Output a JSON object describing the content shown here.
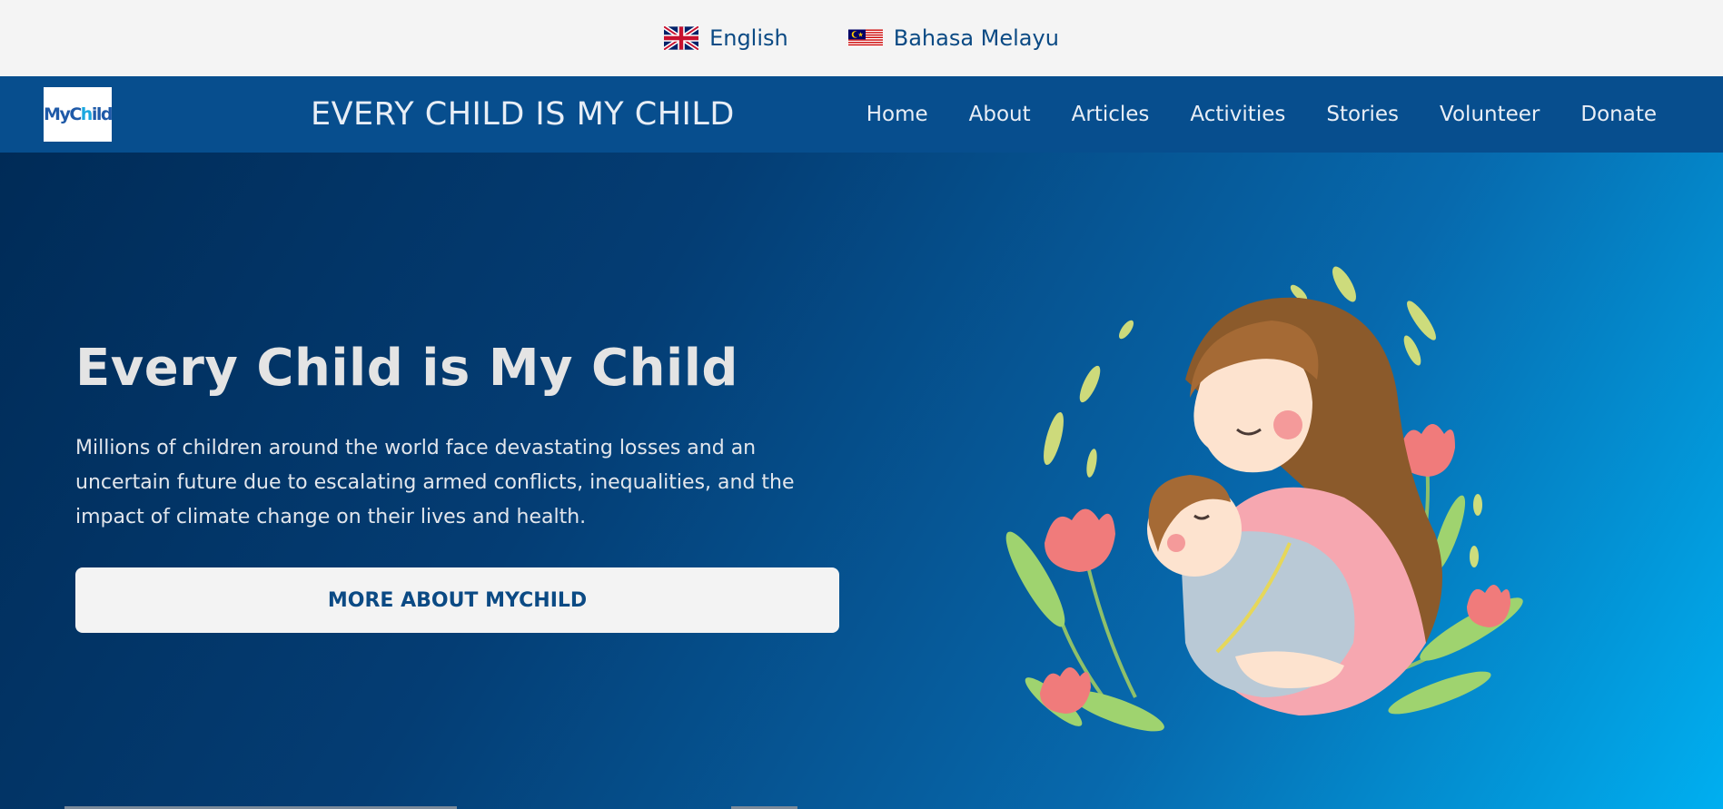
{
  "language_bar": {
    "items": [
      {
        "label": "English",
        "flag": "uk-flag-icon"
      },
      {
        "label": "Bahasa Melayu",
        "flag": "malaysia-flag-icon"
      }
    ]
  },
  "navbar": {
    "logo_text_a": "MyC",
    "logo_text_b": "h",
    "logo_text_c": "ild",
    "site_title": "EVERY CHILD IS MY CHILD",
    "menu": [
      "Home",
      "About",
      "Articles",
      "Activities",
      "Stories",
      "Volunteer",
      "Donate"
    ]
  },
  "hero": {
    "title": "Every Child is My Child",
    "description": "Millions of children around the world face devastating losses and an uncertain future due to escalating armed conflicts, inequalities, and the impact of climate change on their lives and health.",
    "button_label": "MORE ABOUT MYCHILD",
    "illustration": "mother-holding-baby-illustration"
  },
  "colors": {
    "lang_bar_bg": "#f4f4f4",
    "navbar_bg": "#074e8e",
    "hero_gradient_start": "#002b57",
    "hero_gradient_end": "#00aff0",
    "button_bg": "#f3f3f3",
    "brand_text": "#0b4a84"
  }
}
